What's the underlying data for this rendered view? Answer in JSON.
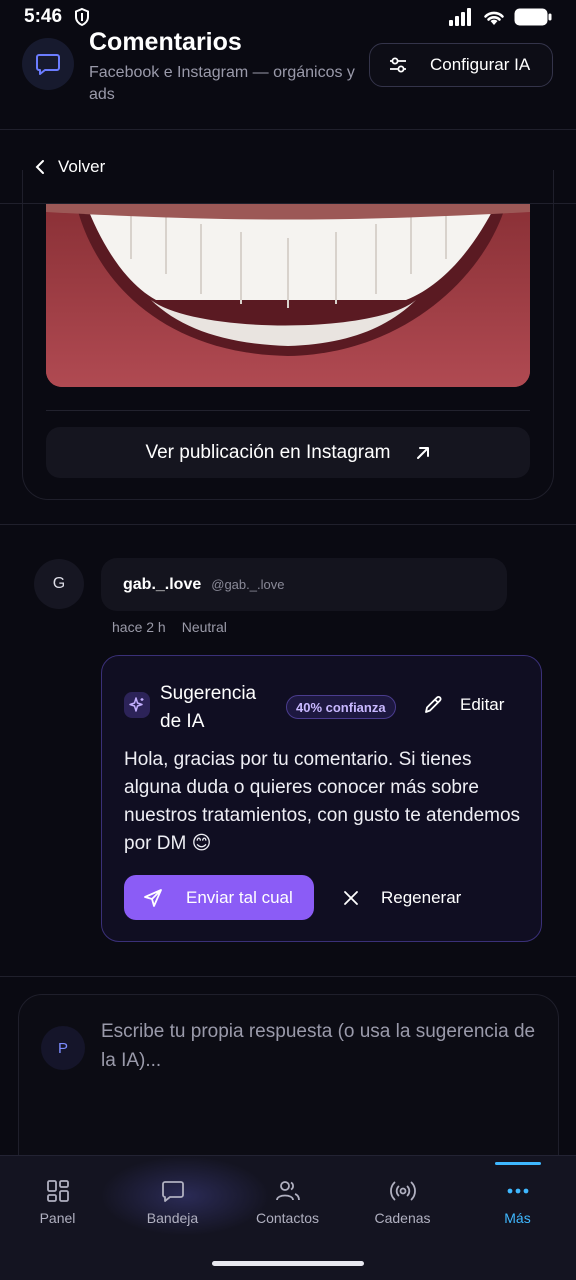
{
  "status_bar": {
    "time": "5:46"
  },
  "header": {
    "title": "Comentarios",
    "subtitle": "Facebook e Instagram — orgánicos y ads",
    "config_button": "Configurar IA"
  },
  "back": {
    "label": "Volver"
  },
  "post": {
    "view_button": "Ver publicación en Instagram"
  },
  "comment": {
    "avatar_initial": "G",
    "username": "gab._.love",
    "handle": "@gab._.love",
    "time": "hace 2 h",
    "sentiment": "Neutral"
  },
  "ai_suggestion": {
    "title": "Sugerencia de IA",
    "confidence": "40% confianza",
    "edit_label": "Editar",
    "text": "Hola, gracias por tu comentario. Si tienes alguna duda o quieres conocer más sobre nuestros tratamientos, con gusto te atendemos por DM 😊",
    "send_label": "Enviar tal cual",
    "regenerate_label": "Regenerar",
    "accent_color": "#8b5cf6"
  },
  "reply": {
    "avatar_initial": "P",
    "placeholder": "Escribe tu propia respuesta (o usa la sugerencia de la IA)..."
  },
  "bottom_nav": {
    "items": [
      {
        "label": "Panel",
        "icon": "grid-icon"
      },
      {
        "label": "Bandeja",
        "icon": "chat-icon"
      },
      {
        "label": "Contactos",
        "icon": "users-icon"
      },
      {
        "label": "Cadenas",
        "icon": "broadcast-icon"
      },
      {
        "label": "Más",
        "icon": "more-icon"
      }
    ],
    "active": "Más",
    "active_color": "#3fb8ff"
  }
}
